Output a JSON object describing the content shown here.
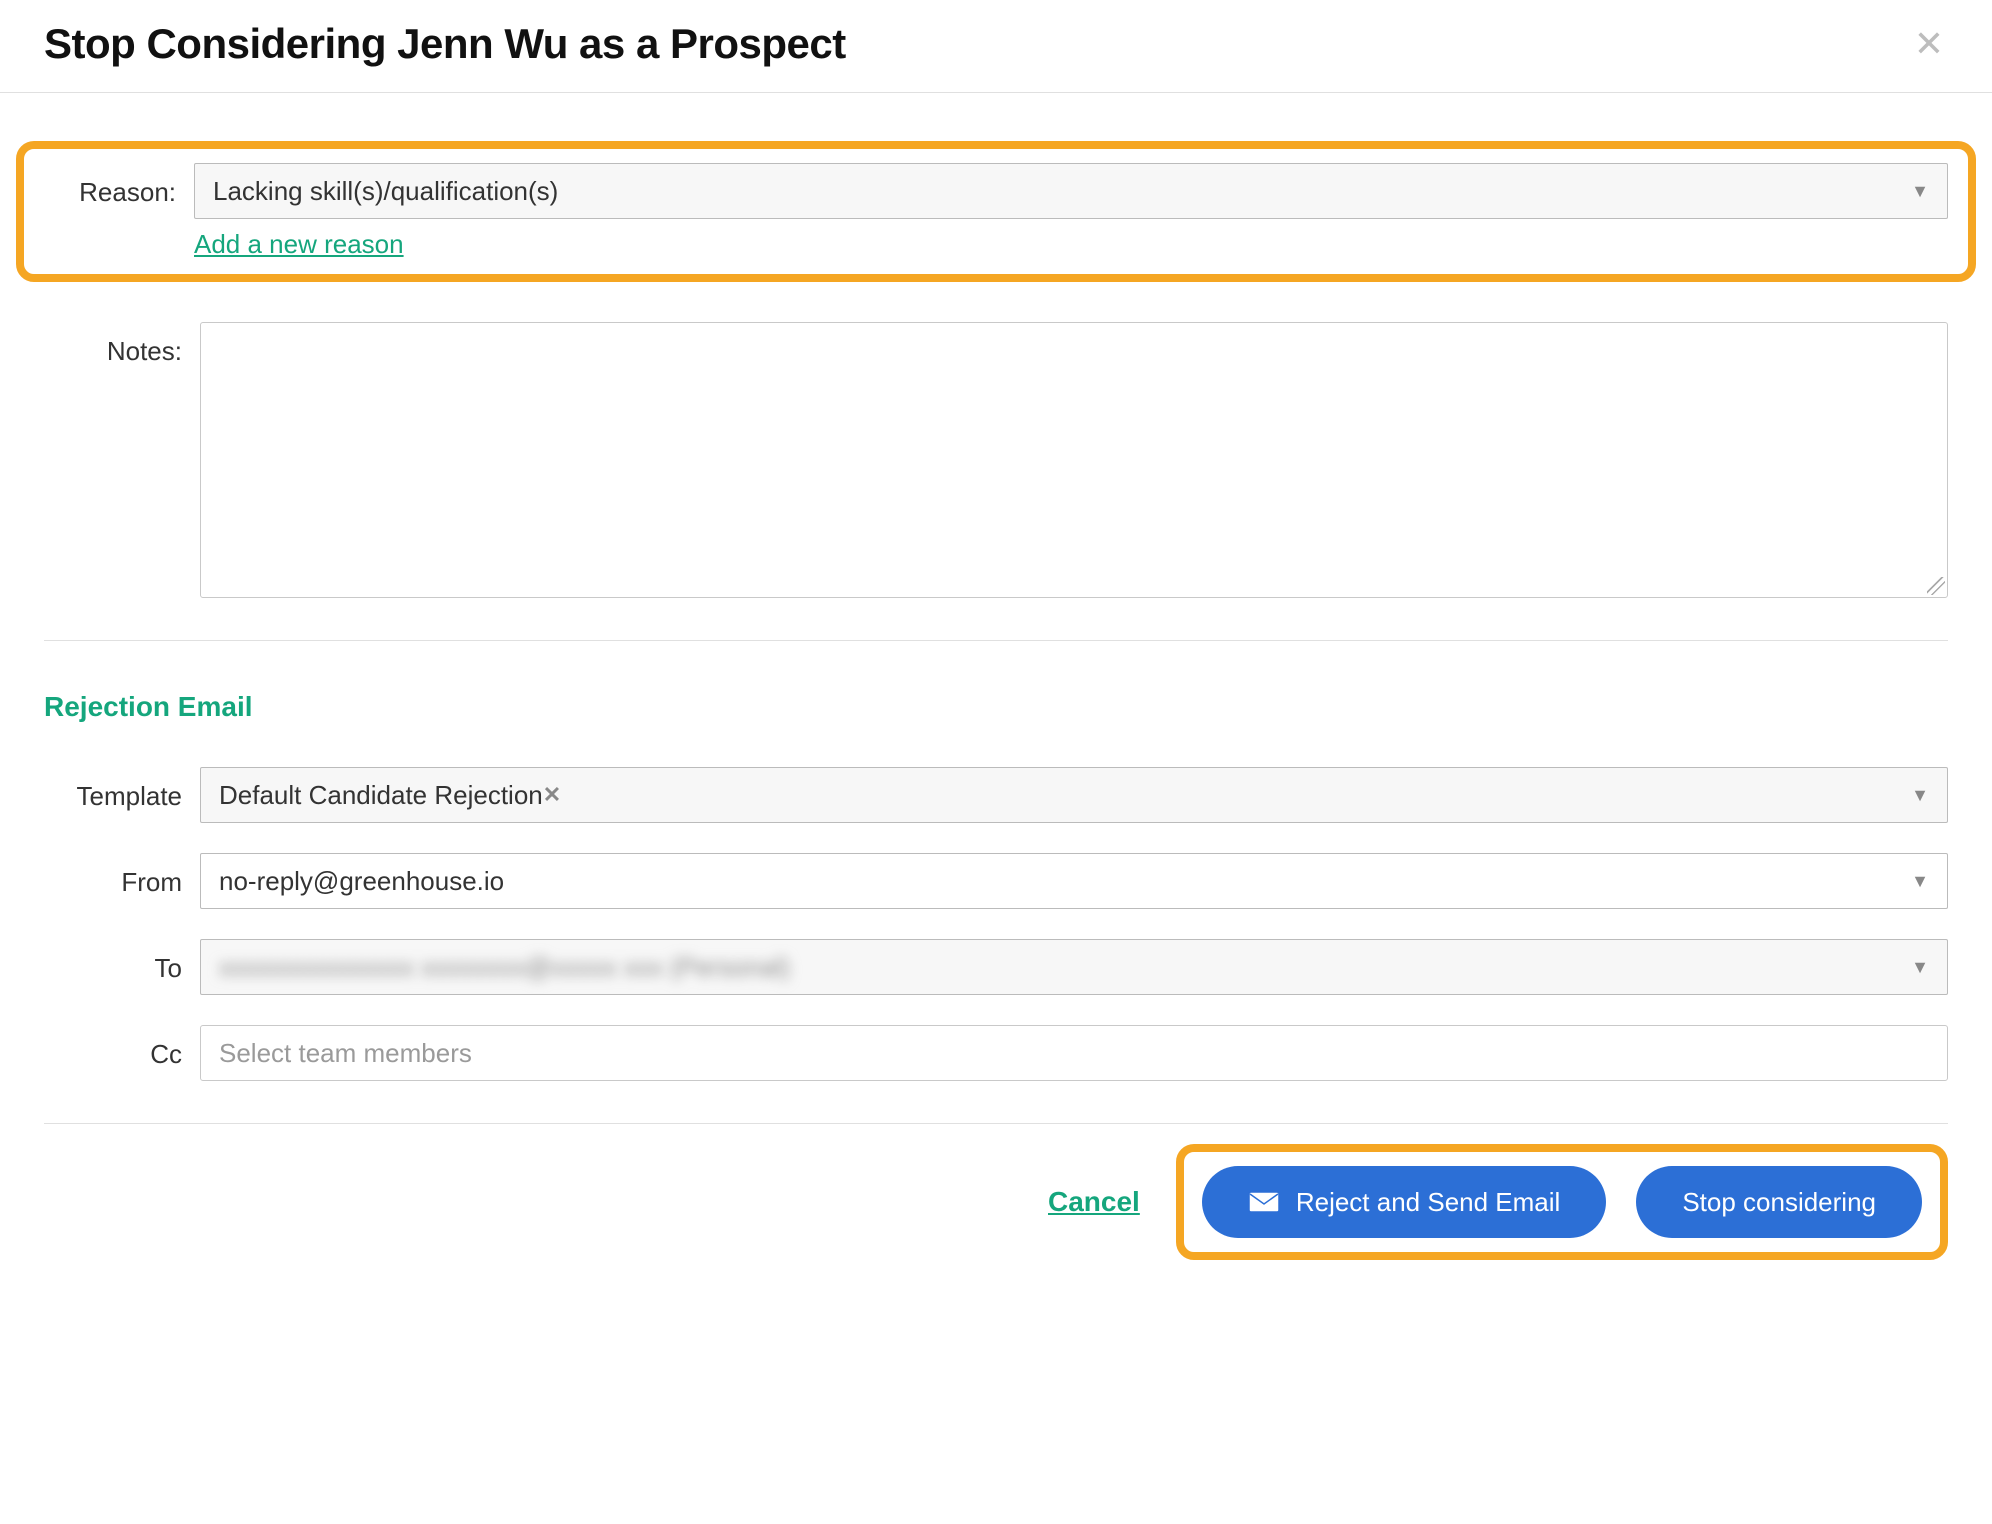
{
  "header": {
    "title": "Stop Considering Jenn Wu as a Prospect"
  },
  "reason": {
    "label": "Reason:",
    "value": "Lacking skill(s)/qualification(s)",
    "add_link": "Add a new reason"
  },
  "notes": {
    "label": "Notes:"
  },
  "rejection_email": {
    "heading": "Rejection Email",
    "template": {
      "label": "Template",
      "value": "Default Candidate Rejection"
    },
    "from": {
      "label": "From",
      "value": "no-reply@greenhouse.io"
    },
    "to": {
      "label": "To",
      "value": "xxxxxxxxxxxxxxx xxxxxxxx@xxxxx xxx (Personal)"
    },
    "cc": {
      "label": "Cc",
      "placeholder": "Select team members"
    }
  },
  "footer": {
    "cancel": "Cancel",
    "reject_and_send": "Reject and Send Email",
    "stop_considering": "Stop considering"
  }
}
